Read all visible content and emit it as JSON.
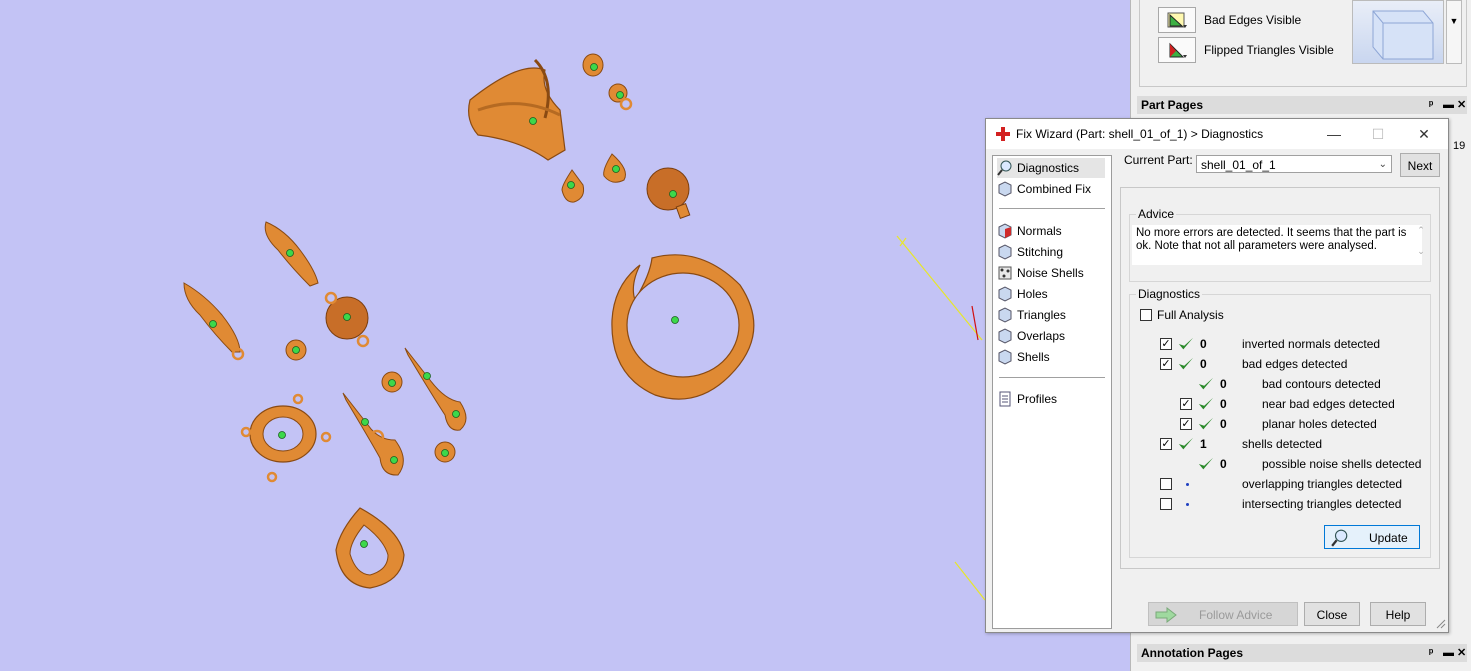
{
  "viewport": {
    "background": "#c3c3f5",
    "part_color": "#e08a34"
  },
  "right_panel": {
    "vis_rows": [
      {
        "label": "Bad Edges Visible",
        "icon": "bad-edges-icon"
      },
      {
        "label": "Flipped Triangles Visible",
        "icon": "flipped-triangles-icon"
      }
    ],
    "part_pages": {
      "title": "Part Pages",
      "side_value": "19"
    },
    "annotation_pages": {
      "title": "Annotation Pages"
    }
  },
  "dialog": {
    "title": "Fix Wizard (Part: shell_01_of_1) > Diagnostics",
    "nav": {
      "group1": [
        {
          "label": "Diagnostics",
          "icon": "magnifier-icon",
          "selected": true
        },
        {
          "label": "Combined Fix",
          "icon": "cube-icon"
        }
      ],
      "group2": [
        {
          "label": "Normals",
          "icon": "normals-icon"
        },
        {
          "label": "Stitching",
          "icon": "stitching-icon"
        },
        {
          "label": "Noise Shells",
          "icon": "noise-shells-icon"
        },
        {
          "label": "Holes",
          "icon": "holes-icon"
        },
        {
          "label": "Triangles",
          "icon": "triangles-icon"
        },
        {
          "label": "Overlaps",
          "icon": "overlaps-icon"
        },
        {
          "label": "Shells",
          "icon": "shells-icon"
        }
      ],
      "group3": [
        {
          "label": "Profiles",
          "icon": "profiles-icon"
        }
      ]
    },
    "current_part_label": "Current Part:",
    "current_part_value": "shell_01_of_1",
    "next_label": "Next",
    "advice": {
      "title": "Advice",
      "text": "No more errors are detected. It seems that the part is ok. Note that not all parameters were analysed."
    },
    "diagnostics": {
      "title": "Diagnostics",
      "full_analysis_label": "Full Analysis",
      "rows": [
        {
          "checkbox": true,
          "checked": true,
          "status": "ok",
          "count": "0",
          "label": "inverted normals detected",
          "indent": 0
        },
        {
          "checkbox": true,
          "checked": true,
          "status": "ok",
          "count": "0",
          "label": "bad edges detected",
          "indent": 0
        },
        {
          "checkbox": false,
          "checked": false,
          "status": "ok",
          "count": "0",
          "label": "bad contours detected",
          "indent": 1
        },
        {
          "checkbox": true,
          "checked": true,
          "status": "ok",
          "count": "0",
          "label": "near bad edges detected",
          "indent": 1
        },
        {
          "checkbox": true,
          "checked": true,
          "status": "ok",
          "count": "0",
          "label": "planar holes detected",
          "indent": 1
        },
        {
          "checkbox": true,
          "checked": true,
          "status": "ok",
          "count": "1",
          "label": "shells detected",
          "indent": 0
        },
        {
          "checkbox": false,
          "checked": false,
          "status": "ok",
          "count": "0",
          "label": "possible noise shells detected",
          "indent": 1
        },
        {
          "checkbox": true,
          "checked": false,
          "status": "none",
          "count": "",
          "label": "overlapping triangles detected",
          "indent": 0
        },
        {
          "checkbox": true,
          "checked": false,
          "status": "none",
          "count": "",
          "label": "intersecting triangles detected",
          "indent": 0
        }
      ],
      "update_label": "Update"
    },
    "follow_advice_label": "Follow Advice",
    "close_label": "Close",
    "help_label": "Help"
  }
}
